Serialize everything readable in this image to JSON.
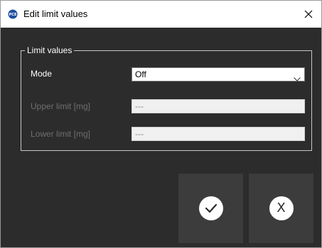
{
  "window": {
    "title": "Edit limit values",
    "app_icon": "pce-logo-icon",
    "close_icon": "close-icon"
  },
  "group": {
    "legend": "Limit values"
  },
  "fields": {
    "mode": {
      "label": "Mode",
      "value": "Off",
      "enabled": true
    },
    "upper": {
      "label": "Upper limit [mg]",
      "value": "---",
      "enabled": false
    },
    "lower": {
      "label": "Lower limit [mg]",
      "value": "---",
      "enabled": false
    }
  },
  "buttons": {
    "ok": {
      "icon": "checkmark-icon"
    },
    "cancel": {
      "icon": "cancel-x-icon",
      "glyph": "X"
    }
  },
  "colors": {
    "background": "#2c2c2c",
    "button_bg": "#3c3c3c",
    "disabled_text": "#6f6f6f",
    "app_icon_blue": "#1f4fa0"
  }
}
